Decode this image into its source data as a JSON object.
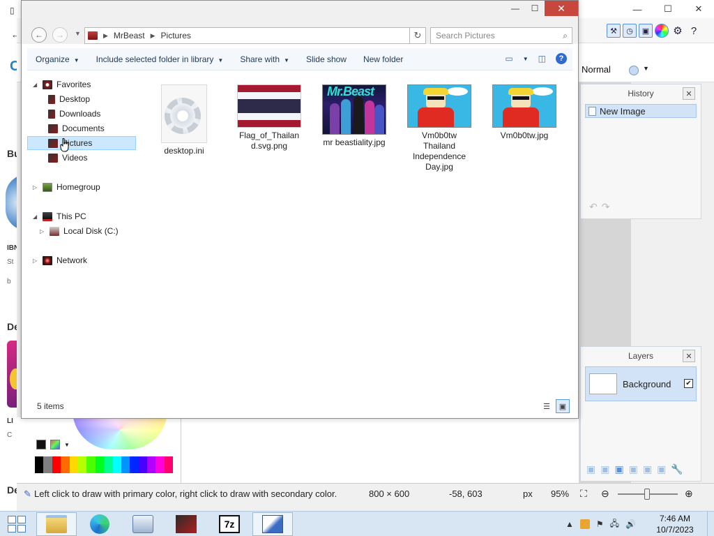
{
  "edge": {
    "fragments": [
      "C",
      "Bu",
      "IBN",
      "St",
      "b",
      "De",
      "LI",
      "C",
      "De"
    ]
  },
  "paintnet": {
    "caption_buttons": [
      "—",
      "☐",
      "✕"
    ],
    "blend_mode": "Normal",
    "history": {
      "title": "History",
      "items": [
        "New Image"
      ]
    },
    "layers": {
      "title": "Layers",
      "items": [
        {
          "name": "Background",
          "visible": true
        }
      ]
    },
    "status": {
      "hint": "Left click to draw with primary color, right click to draw with secondary color.",
      "image_size": "800 × 600",
      "cursor_position": "-58, 603",
      "unit": "px",
      "zoom": "95%"
    },
    "palette_colors": [
      "#000000",
      "#7f7f7f",
      "#ff0000",
      "#ff6a00",
      "#ffd800",
      "#b6ff00",
      "#4cff00",
      "#00ff21",
      "#00ff90",
      "#00ffff",
      "#0094ff",
      "#0026ff",
      "#4800ff",
      "#b200ff",
      "#ff00dc",
      "#ff006e"
    ]
  },
  "explorer": {
    "breadcrumb": [
      "MrBeast",
      "Pictures"
    ],
    "search_placeholder": "Search Pictures",
    "commands": [
      "Organize",
      "Include selected folder in library",
      "Share with",
      "Slide show",
      "New folder"
    ],
    "tree": {
      "favorites": "Favorites",
      "favorites_children": [
        "Desktop",
        "Downloads",
        "Documents",
        "Pictures",
        "Videos"
      ],
      "homegroup": "Homegroup",
      "this_pc": "This PC",
      "local_disk": "Local Disk (C:)",
      "network": "Network"
    },
    "files": [
      {
        "name": "desktop.ini",
        "kind": "ini"
      },
      {
        "name": "Flag_of_Thailand.svg.png",
        "kind": "flag"
      },
      {
        "name": "mr beastiality.jpg",
        "kind": "photo"
      },
      {
        "name": "Vm0b0tw Thailand Independence Day.jpg",
        "kind": "comic"
      },
      {
        "name": "Vm0b0tw.jpg",
        "kind": "comic"
      }
    ],
    "status_count": "5 items"
  },
  "taskbar": {
    "apps": [
      "File Explorer",
      "Microsoft Edge",
      "On-Screen Keyboard",
      "MrBeast Folder",
      "7-Zip",
      "Paint.NET"
    ],
    "time": "7:46 AM",
    "date": "10/7/2023"
  }
}
